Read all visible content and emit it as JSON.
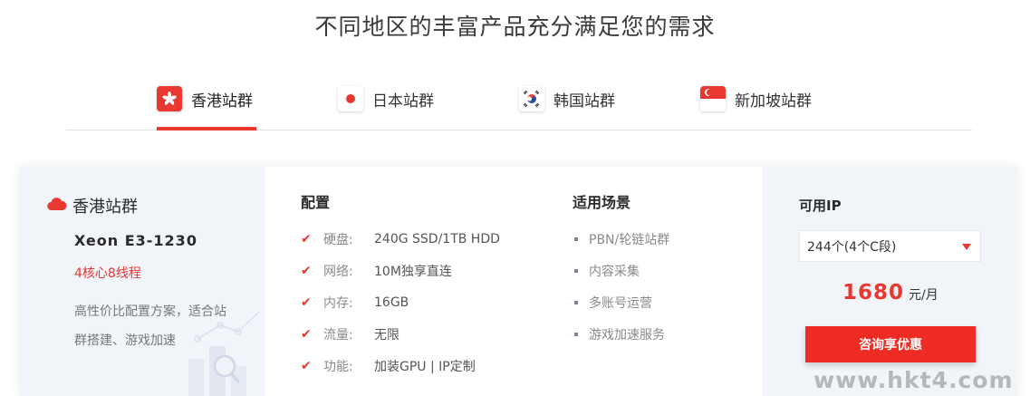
{
  "headline": "不同地区的丰富产品充分满足您的需求",
  "tabs": [
    {
      "label": "香港站群",
      "flag": "hong-kong-flag",
      "active": true
    },
    {
      "label": "日本站群",
      "flag": "japan-flag",
      "active": false
    },
    {
      "label": "韩国站群",
      "flag": "south-korea-flag",
      "active": false
    },
    {
      "label": "新加坡站群",
      "flag": "singapore-flag",
      "active": false
    }
  ],
  "colors": {
    "accent": "#e8382f",
    "panel_bg": "#f1f4f9",
    "button": "#ee2c24"
  },
  "product": {
    "region_icon": "cloud-icon",
    "region": "香港站群",
    "cpu": "Xeon E3-1230",
    "cores": "4核心8线程",
    "desc_line1": "高性价比配置方案，适合站",
    "desc_line2": "群搭建、游戏加速"
  },
  "config": {
    "title": "配置",
    "rows": [
      {
        "key": "硬盘:",
        "value": "240G SSD/1TB HDD"
      },
      {
        "key": "网络:",
        "value": "10M独享直连"
      },
      {
        "key": "内存:",
        "value": "16GB"
      },
      {
        "key": "流量:",
        "value": "无限"
      },
      {
        "key": "功能:",
        "value": "加装GPU | IP定制"
      }
    ]
  },
  "scenes": {
    "title": "适用场景",
    "items": [
      "PBN/轮链站群",
      "内容采集",
      "多账号运营",
      "游戏加速服务"
    ]
  },
  "purchase": {
    "ip_title": "可用IP",
    "ip_selected": "244个(4个C段)",
    "price": "1680",
    "unit": "元/月",
    "cta": "咨询享优惠"
  },
  "watermark": "www.hkt4.com"
}
